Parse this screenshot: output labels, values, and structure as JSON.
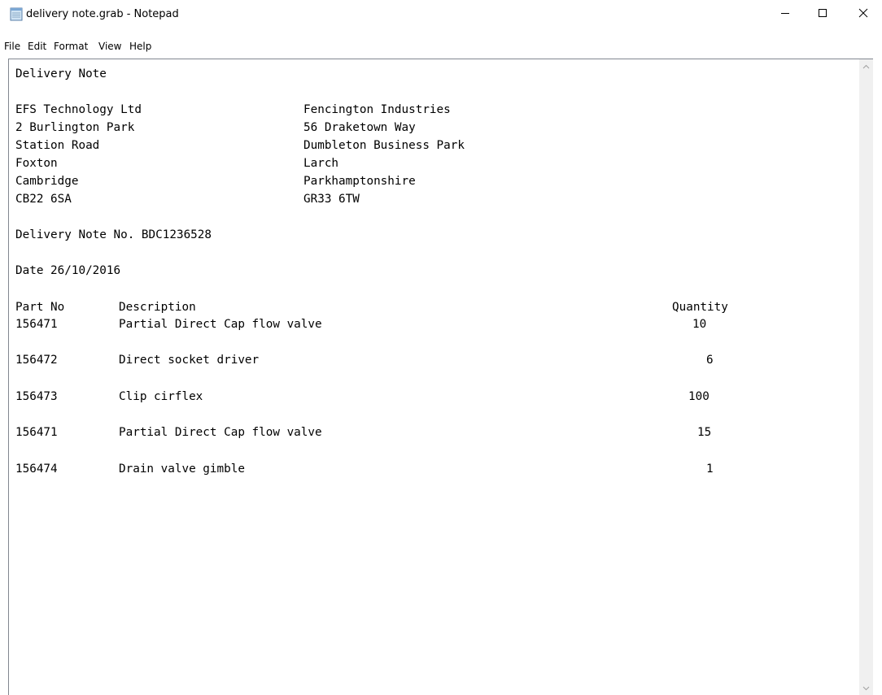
{
  "window": {
    "title": "delivery note.grab - Notepad",
    "controls": {
      "minimize": "minimize-icon",
      "maximize": "maximize-icon",
      "close": "close-icon"
    }
  },
  "menu": [
    "File",
    "Edit",
    "Format",
    "View",
    "Help"
  ],
  "document": {
    "heading": "Delivery Note",
    "sender": [
      "EFS Technology Ltd",
      "2 Burlington Park",
      "Station Road",
      "Foxton",
      "Cambridge",
      "CB22 6SA"
    ],
    "recipient": [
      "Fencington Industries",
      "56 Draketown Way",
      "Dumbleton Business Park",
      "Larch",
      "Parkhamptonshire",
      "GR33 6TW"
    ],
    "note_number_line": "Delivery Note No. BDC1236528",
    "date_line": "Date 26/10/2016",
    "table_headers": {
      "part_no": "Part No",
      "description": "Description",
      "quantity": "Quantity"
    },
    "items": [
      {
        "part_no": "156471",
        "description": "Partial Direct Cap flow valve",
        "quantity": "10"
      },
      {
        "part_no": "156472",
        "description": "Direct socket driver",
        "quantity": "6"
      },
      {
        "part_no": "156473",
        "description": "Clip cirflex",
        "quantity": "100"
      },
      {
        "part_no": "156471",
        "description": "Partial Direct Cap flow valve",
        "quantity": "15"
      },
      {
        "part_no": "156474",
        "description": "Drain valve gimble",
        "quantity": "1"
      }
    ]
  }
}
